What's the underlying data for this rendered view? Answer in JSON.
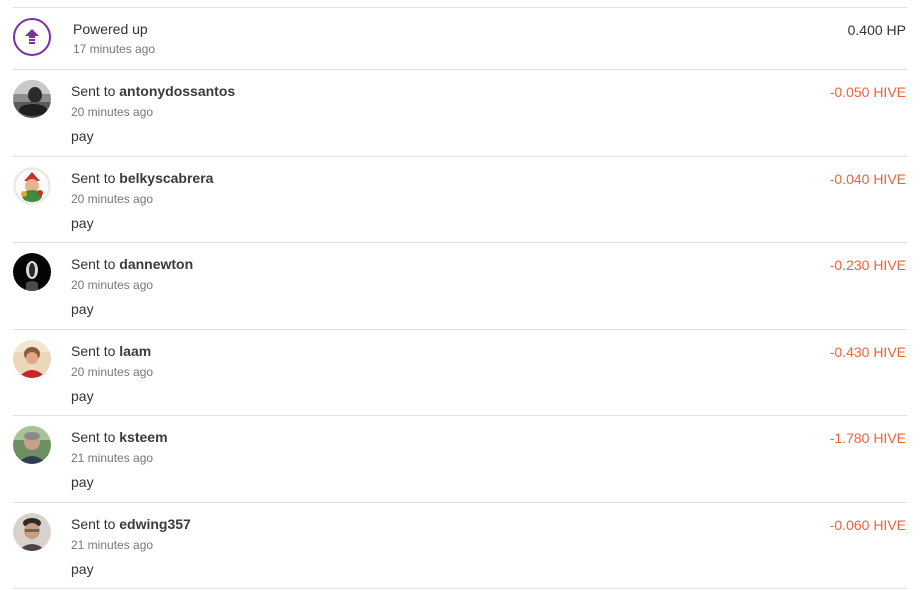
{
  "power_up": {
    "title": "Powered up",
    "time": "17 minutes ago",
    "amount": "0.400 HP",
    "icon": "arrow-up-icon",
    "icon_color": "#7b2fa8"
  },
  "transfers": [
    {
      "prefix": "Sent to",
      "user": "antonydossantos",
      "time": "20 minutes ago",
      "memo": "pay",
      "amount": "-0.050 HIVE"
    },
    {
      "prefix": "Sent to",
      "user": "belkyscabrera",
      "time": "20 minutes ago",
      "memo": "pay",
      "amount": "-0.040 HIVE"
    },
    {
      "prefix": "Sent to",
      "user": "dannewton",
      "time": "20 minutes ago",
      "memo": "pay",
      "amount": "-0.230 HIVE"
    },
    {
      "prefix": "Sent to",
      "user": "laam",
      "time": "20 minutes ago",
      "memo": "pay",
      "amount": "-0.430 HIVE"
    },
    {
      "prefix": "Sent to",
      "user": "ksteem",
      "time": "21 minutes ago",
      "memo": "pay",
      "amount": "-1.780 HIVE"
    },
    {
      "prefix": "Sent to",
      "user": "edwing357",
      "time": "21 minutes ago",
      "memo": "pay",
      "amount": "-0.060 HIVE"
    }
  ],
  "colors": {
    "negative_amount": "#f0623a",
    "divider": "#e2e2e2"
  }
}
